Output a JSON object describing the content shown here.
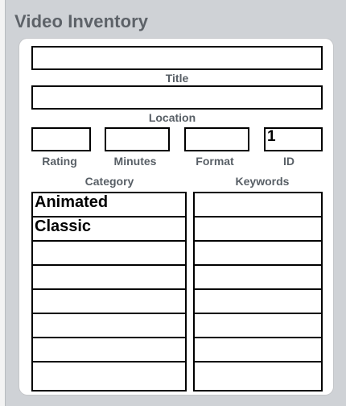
{
  "header": {
    "title": "Video Inventory"
  },
  "fields": {
    "title_label": "Title",
    "title_value": "",
    "location_label": "Location",
    "location_value": "",
    "rating_label": "Rating",
    "rating_value": "",
    "minutes_label": "Minutes",
    "minutes_value": "",
    "format_label": "Format",
    "format_value": "",
    "id_label": "ID",
    "id_value": "1"
  },
  "lists": {
    "category_label": "Category",
    "category_items": [
      "Animated",
      "Classic",
      "",
      "",
      "",
      "",
      "",
      ""
    ],
    "keywords_label": "Keywords",
    "keywords_items": [
      "",
      "",
      "",
      "",
      "",
      "",
      "",
      ""
    ]
  }
}
